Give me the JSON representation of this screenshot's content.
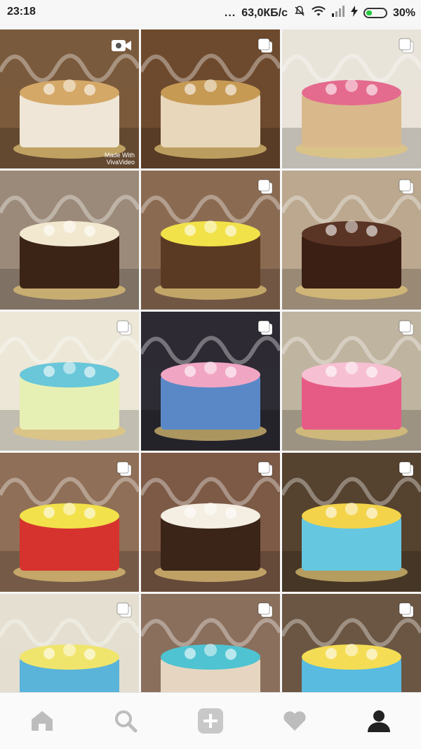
{
  "status_bar": {
    "time": "23:18",
    "more": "...",
    "network_speed": "63,0КБ/с",
    "battery_percent": "30%",
    "battery_level": 0.3
  },
  "grid": {
    "tiles": [
      {
        "id": 1,
        "badge": "video-icon",
        "palette": [
          "#7b5a3c",
          "#d4a867",
          "#efe6d7"
        ],
        "watermark": "Made With\nVivaVideo"
      },
      {
        "id": 2,
        "badge": "multiple-photos-icon",
        "palette": [
          "#6d4a2e",
          "#c79a54",
          "#e8d7bb"
        ]
      },
      {
        "id": 3,
        "badge": "multiple-photos-icon",
        "palette": [
          "#e9e3da",
          "#e46b8e",
          "#d9b98b"
        ]
      },
      {
        "id": 4,
        "badge": "none",
        "palette": [
          "#9b8a79",
          "#f2e8cf",
          "#3b2416"
        ]
      },
      {
        "id": 5,
        "badge": "multiple-photos-icon",
        "palette": [
          "#8a6b52",
          "#f2e24a",
          "#5a3a22"
        ]
      },
      {
        "id": 6,
        "badge": "multiple-photos-icon",
        "palette": [
          "#bba88f",
          "#5a3424",
          "#3b1f14"
        ]
      },
      {
        "id": 7,
        "badge": "multiple-photos-icon",
        "palette": [
          "#ece7d7",
          "#69c7d9",
          "#e7f0b4"
        ]
      },
      {
        "id": 8,
        "badge": "multiple-photos-icon",
        "palette": [
          "#2d2b34",
          "#f0a6c3",
          "#5a88c7"
        ]
      },
      {
        "id": 9,
        "badge": "multiple-photos-icon",
        "palette": [
          "#bfb4a0",
          "#f7c0d2",
          "#e65b86"
        ]
      },
      {
        "id": 10,
        "badge": "multiple-photos-icon",
        "palette": [
          "#8f6f57",
          "#f2e14a",
          "#d6332f"
        ]
      },
      {
        "id": 11,
        "badge": "multiple-photos-icon",
        "palette": [
          "#7c5a46",
          "#f4eee3",
          "#3b2418"
        ]
      },
      {
        "id": 12,
        "badge": "multiple-photos-icon",
        "palette": [
          "#55422f",
          "#f3d34a",
          "#66c7e0"
        ]
      },
      {
        "id": 13,
        "badge": "multiple-photos-icon",
        "palette": [
          "#e4ded0",
          "#f0e56c",
          "#5ab3d8"
        ]
      },
      {
        "id": 14,
        "badge": "multiple-photos-icon",
        "palette": [
          "#8a6f5d",
          "#4fc3d1",
          "#e6d6c1"
        ]
      },
      {
        "id": 15,
        "badge": "multiple-photos-icon",
        "palette": [
          "#6b5644",
          "#f4dd55",
          "#59bbe0"
        ]
      }
    ]
  },
  "bottom_nav": {
    "items": [
      {
        "name": "home-icon",
        "active": false
      },
      {
        "name": "search-icon",
        "active": false
      },
      {
        "name": "add-post-icon",
        "active": false
      },
      {
        "name": "activity-heart-icon",
        "active": false
      },
      {
        "name": "profile-icon",
        "active": true
      }
    ]
  }
}
